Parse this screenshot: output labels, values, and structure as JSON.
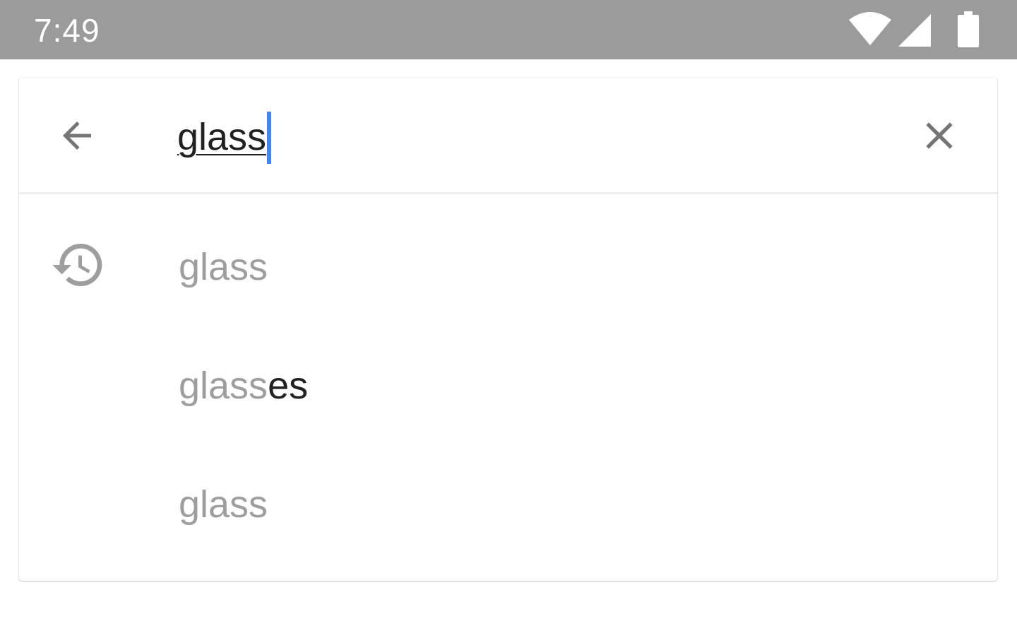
{
  "status_bar": {
    "time": "7:49",
    "icons": [
      "wifi-icon",
      "cell-signal-icon",
      "battery-icon"
    ]
  },
  "search": {
    "query": "glass",
    "back_icon": "arrow-back-icon",
    "clear_icon": "close-icon"
  },
  "suggestions": [
    {
      "typed": "glass",
      "completion": "",
      "icon": "history-icon"
    },
    {
      "typed": "glass",
      "completion": "es",
      "icon": ""
    },
    {
      "typed": "glass",
      "completion": "",
      "icon": ""
    }
  ],
  "colors": {
    "status_bar_bg": "#9b9b9b",
    "caret": "#4285f4",
    "muted_text": "#9e9e9e",
    "primary_text": "#212121",
    "icon_gray": "#757575"
  }
}
